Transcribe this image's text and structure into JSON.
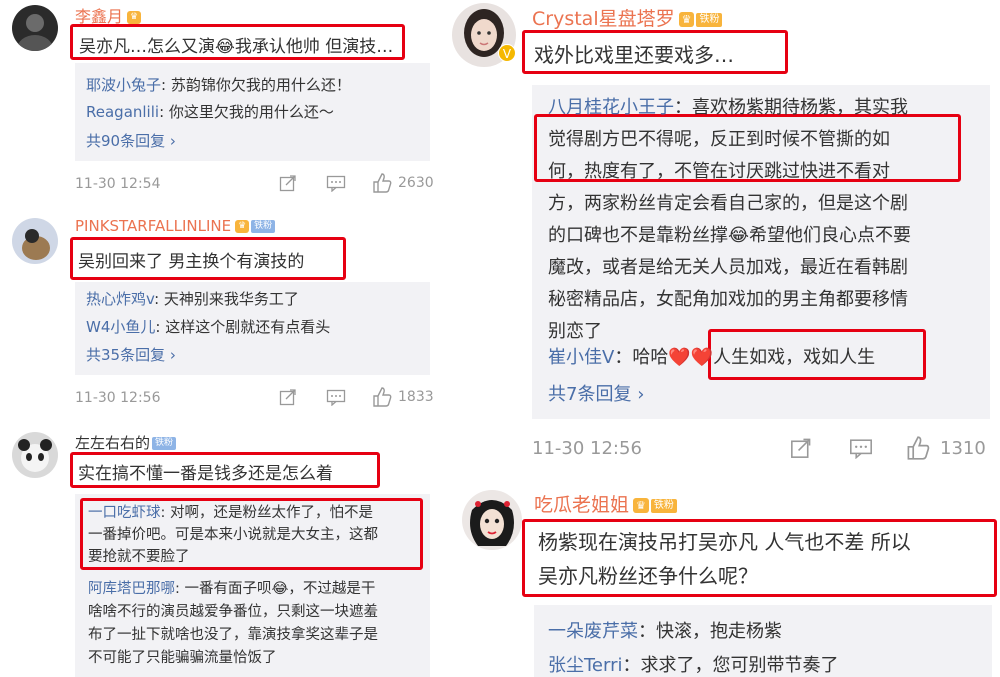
{
  "left": {
    "c1": {
      "name": "李鑫月",
      "text": "吴亦凡…怎么又演😂我承认他帅 但演技…",
      "replies": [
        {
          "name": "耶波小兔子",
          "text": ": 苏韵锦你欠我的用什么还！"
        },
        {
          "name": "Reaganlili",
          "text": ": 你这里欠我的用什么还～"
        }
      ],
      "more": "共90条回复",
      "time": "11-30 12:54",
      "likes": "2630"
    },
    "c2": {
      "name": "PINKSTARFALLINLINE",
      "fan": "铁粉",
      "text": "吴别回来了 男主换个有演技的",
      "replies": [
        {
          "name": "热心炸鸡v",
          "text": ": 天神别来我华务工了"
        },
        {
          "name": "W4小鱼儿",
          "text": ": 这样这个剧就还有点看头"
        }
      ],
      "more": "共35条回复",
      "time": "11-30 12:56",
      "likes": "1833"
    },
    "c3": {
      "name": "左左右右的",
      "fan": "铁粉",
      "text": "实在搞不懂一番是钱多还是怎么着",
      "reply1_name": "一口吃虾球",
      "reply1_lines": [
        ": 对啊，还是粉丝太作了，怕不是",
        "一番掉价吧。可是本来小说就是大女主，这都",
        "要抢就不要脸了"
      ],
      "reply2_name": "阿库塔巴那哪",
      "reply2_lines": [
        ": 一番有面子呗😂，不过越是干",
        "啥啥不行的演员越爱争番位，只剩这一块遮羞",
        "布了一扯下就啥也没了，靠演技拿奖这辈子是",
        "不可能了只能骗骗流量恰饭了"
      ]
    }
  },
  "right": {
    "c1": {
      "name": "Crystal星盘塔罗",
      "fan": "铁粉",
      "text": "戏外比戏里还要戏多…",
      "reply1_name": "八月桂花小王子",
      "reply1_lines": [
        "：喜欢杨紫期待杨紫，其实我",
        "觉得剧方巴不得呢，反正到时候不管撕的如",
        "何，热度有了，不管在讨厌跳过快进不看对",
        "方，两家粉丝肯定会看自己家的，但是这个剧",
        "的口碑也不是靠粉丝撑😂希望他们良心点不要",
        "魔改，或者是给无关人员加戏，最近在看韩剧",
        "秘密精品店，女配角加戏加的男主角都要移情",
        "别恋了"
      ],
      "reply2_name": "崔小佳V",
      "reply2_pre": "：哈哈❤️❤️",
      "reply2_hl": "人生如戏，戏如人生",
      "more": "共7条回复",
      "time": "11-30 12:56",
      "likes": "1310"
    },
    "c2": {
      "name": "吃瓜老姐姐",
      "fan": "铁粉",
      "text_lines": [
        "杨紫现在演技吊打吴亦凡 人气也不差 所以",
        "吴亦凡粉丝还争什么呢？"
      ],
      "replies": [
        {
          "name": "一朵废芹菜",
          "text": "：快滚，抱走杨紫"
        },
        {
          "name": "张尘Terri",
          "text": "：求求了，您可别带节奏了"
        }
      ]
    }
  },
  "colors": {
    "highlight_border": "#e60012",
    "username": "#eb7350",
    "reply_name": "#4a6ea8",
    "reply_bg": "#f2f2f5",
    "meta": "#999999"
  }
}
